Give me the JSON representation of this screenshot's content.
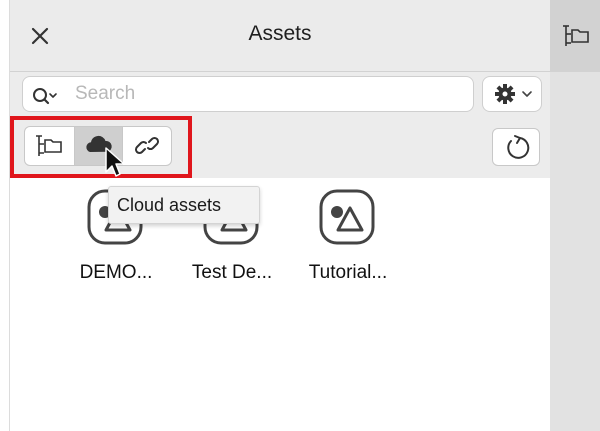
{
  "panel": {
    "title": "Assets"
  },
  "search": {
    "placeholder": "Search",
    "value": ""
  },
  "view_modes": {
    "items": [
      {
        "icon": "hierarchy-icon",
        "active": false
      },
      {
        "icon": "cloud-icon",
        "active": true
      },
      {
        "icon": "link-icon",
        "active": false
      }
    ]
  },
  "tooltip": {
    "text": "Cloud assets"
  },
  "assets": [
    {
      "label": "DEMO...",
      "icon": "design-asset-icon"
    },
    {
      "label": "Test De...",
      "icon": "design-asset-icon"
    },
    {
      "label": "Tutorial...",
      "icon": "design-asset-icon"
    }
  ],
  "colors": {
    "highlight": "#e0161c",
    "title_bar": "#ebebeb",
    "active_segment": "#cfcfcf",
    "rail": "#e2e2e2"
  }
}
